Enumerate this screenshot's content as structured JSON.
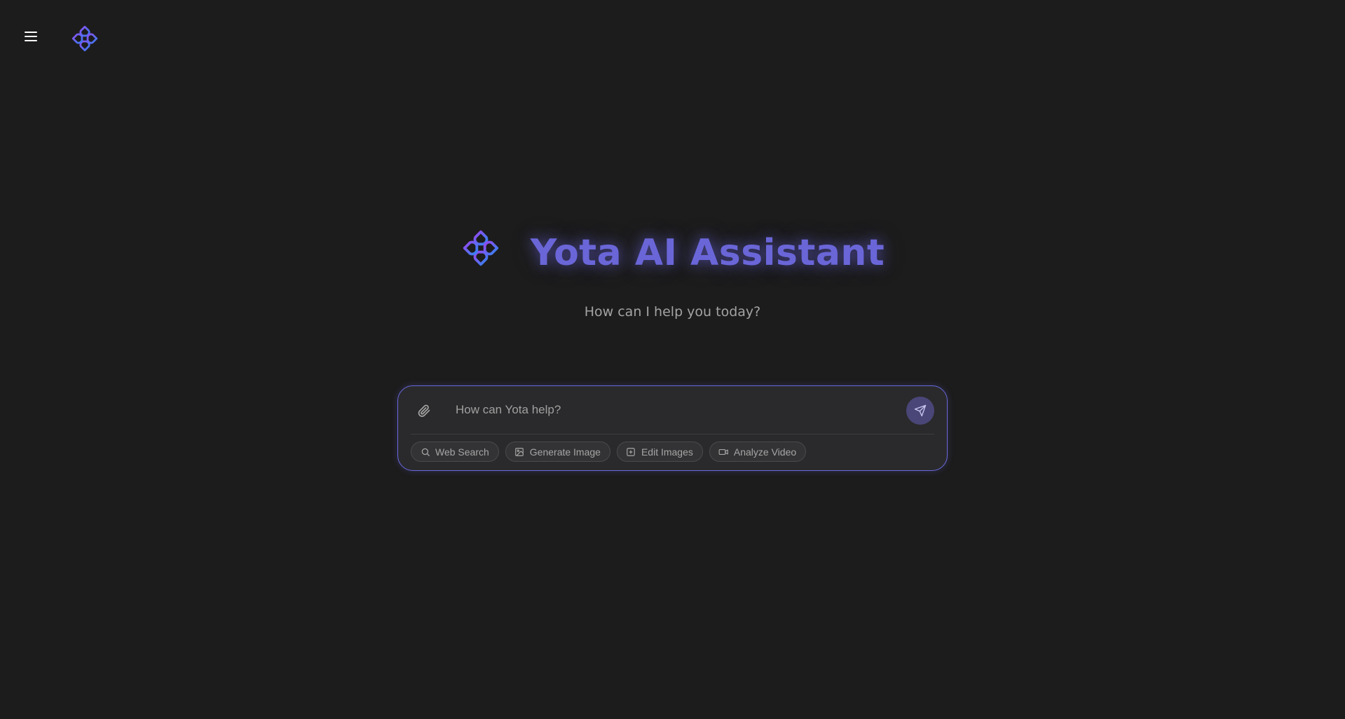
{
  "header": {
    "menu_icon": "hamburger-menu-icon",
    "logo_icon": "yota-logo-icon"
  },
  "hero": {
    "title": "Yota AI Assistant",
    "subtitle": "How can I help you today?",
    "logo_icon": "yota-logo-icon"
  },
  "composer": {
    "placeholder": "How can Yota help?",
    "value": "",
    "attach_icon": "paperclip-icon",
    "send_icon": "send-icon",
    "tools": [
      {
        "label": "Web Search",
        "icon": "search-icon"
      },
      {
        "label": "Generate Image",
        "icon": "image-icon"
      },
      {
        "label": "Edit Images",
        "icon": "edit-image-icon"
      },
      {
        "label": "Analyze Video",
        "icon": "video-icon"
      }
    ]
  },
  "colors": {
    "background": "#1c1c1c",
    "accent": "#6a66d8",
    "composer_border": "#6a68e0",
    "send_button": "#4a4678"
  }
}
